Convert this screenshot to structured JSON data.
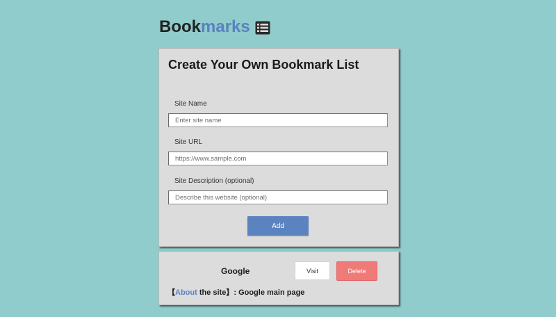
{
  "header": {
    "title_part1": "Book",
    "title_part2": "marks",
    "icon": "list-icon",
    "accent_color": "#5a82bf"
  },
  "form": {
    "heading": "Create Your Own Bookmark List",
    "fields": [
      {
        "label": "Site Name",
        "placeholder": "Enter site name",
        "value": ""
      },
      {
        "label": "Site URL",
        "placeholder": "https://www.sample.com",
        "value": ""
      },
      {
        "label": "Site Description (optional)",
        "placeholder": "Describe this website (optional)",
        "value": ""
      }
    ],
    "add_label": "Add"
  },
  "bookmarks": [
    {
      "name": "Google",
      "visit_label": "Visit",
      "delete_label": "Delete",
      "desc_open": "【",
      "desc_accent": "About",
      "desc_rest": " the site】: ",
      "description": "Google main page"
    }
  ],
  "colors": {
    "background": "#8fcccb",
    "card": "#dcdcdc",
    "add_button": "#5b83c0",
    "delete_button": "#ef7a78"
  }
}
